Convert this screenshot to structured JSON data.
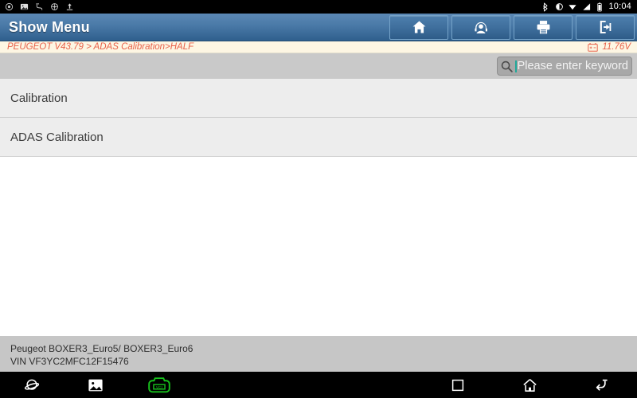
{
  "statusbar": {
    "left_icons": [
      {
        "name": "screenshot-icon",
        "glyph": "screenshot"
      },
      {
        "name": "gallery-icon",
        "glyph": "image"
      },
      {
        "name": "usb-debug-icon",
        "glyph": "usb"
      },
      {
        "name": "settings-sync-icon",
        "glyph": "sync"
      },
      {
        "name": "upload-icon",
        "glyph": "upload"
      }
    ],
    "right_icons": [
      {
        "name": "bluetooth-icon",
        "glyph": "bluetooth"
      },
      {
        "name": "brightness-icon",
        "glyph": "brightness"
      },
      {
        "name": "wifi-icon",
        "glyph": "wifi"
      },
      {
        "name": "cellular-signal-icon",
        "glyph": "signal"
      },
      {
        "name": "battery-icon",
        "glyph": "battery"
      }
    ],
    "clock": "10:04"
  },
  "header": {
    "title": "Show Menu",
    "buttons": [
      {
        "name": "home-button",
        "icon": "home-icon",
        "label": "Home"
      },
      {
        "name": "support-button",
        "icon": "headset-icon",
        "label": "Support"
      },
      {
        "name": "print-button",
        "icon": "printer-icon",
        "label": "Print"
      },
      {
        "name": "exit-button",
        "icon": "exit-icon",
        "label": "Exit"
      }
    ]
  },
  "pathbar": {
    "breadcrumb": "PEUGEOT V43.79 > ADAS Calibration>HALF",
    "voltage": "11.76V",
    "voltage_icon": "battery-voltage-icon",
    "accent_color": "#e8614a"
  },
  "search": {
    "icon": "search-icon",
    "placeholder": "Please enter keyword",
    "value": "",
    "caret_color": "#1fa89a"
  },
  "menu": {
    "items": [
      {
        "label": "Calibration"
      },
      {
        "label": "ADAS Calibration"
      }
    ]
  },
  "vehicle_info": {
    "model": "Peugeot BOXER3_Euro5/ BOXER3_Euro6",
    "vin": "VIN VF3YC2MFC12F15476"
  },
  "navbar": {
    "items": [
      {
        "name": "browser-button",
        "icon": "planet-icon",
        "color": "#ffffff"
      },
      {
        "name": "screenshot-gallery-button",
        "icon": "image-icon",
        "color": "#ffffff"
      },
      {
        "name": "vci-status-button",
        "icon": "vci-icon",
        "color": "#17c21c",
        "label": "VCI"
      },
      {
        "name": "recents-button",
        "icon": "square-icon",
        "color": "#ffffff"
      },
      {
        "name": "android-home-button",
        "icon": "home-outline-icon",
        "color": "#ffffff"
      },
      {
        "name": "back-button",
        "icon": "back-arrow-icon",
        "color": "#ffffff"
      }
    ]
  },
  "colors": {
    "title_blue": "#3f6f9d",
    "path_bg": "#fdf6e3",
    "band_gray": "#c9c9c9",
    "item_gray": "#ededed",
    "footer_gray": "#c6c6c6"
  }
}
